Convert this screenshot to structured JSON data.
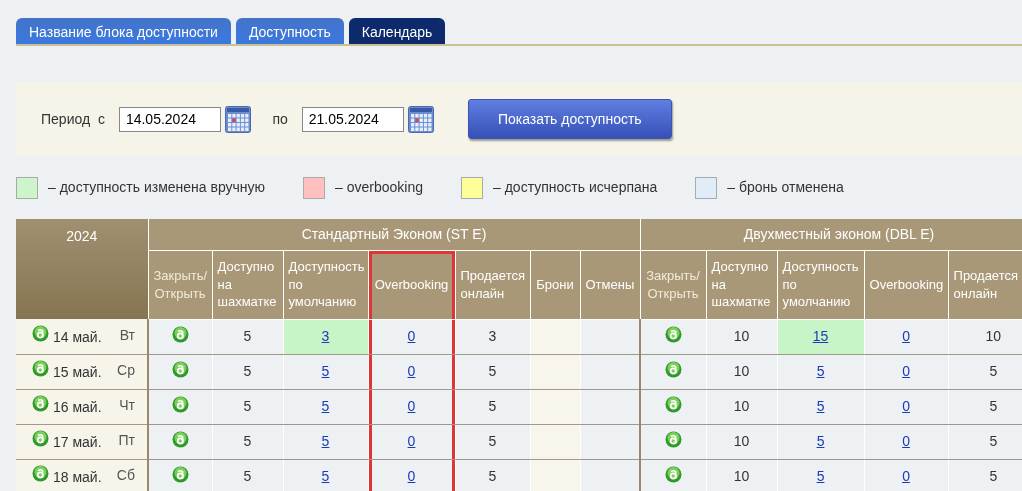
{
  "tabs": [
    {
      "label": "Название блока доступности",
      "selected": false
    },
    {
      "label": "Доступность",
      "selected": false
    },
    {
      "label": "Календарь",
      "selected": true
    }
  ],
  "filter": {
    "period_label": "Период  с",
    "date_from": "14.05.2024",
    "to_label": "по",
    "date_to": "21.05.2024",
    "button": "Показать доступность"
  },
  "legend": [
    {
      "color": "#ccf5cc",
      "label": "– доступность изменена вручную"
    },
    {
      "color": "#ffc0c0",
      "label": "– overbooking"
    },
    {
      "color": "#ffff99",
      "label": "– доступность исчерпана"
    },
    {
      "color": "#e0ecf8",
      "label": "– бронь отменена"
    }
  ],
  "table": {
    "year": "2024",
    "rooms": [
      {
        "name": "Стандартный Эконом (ST E)",
        "columns": [
          {
            "kind": "toggle",
            "label": "Закрыть/ Открыть",
            "highlighted": false
          },
          {
            "kind": "available",
            "label": "Доступно на шахматке",
            "highlighted": false
          },
          {
            "kind": "default",
            "label": "Доступность по умолчанию",
            "highlighted": false
          },
          {
            "kind": "overbooking",
            "label": "Overbooking",
            "highlighted": true
          },
          {
            "kind": "online",
            "label": "Продается онлайн",
            "highlighted": false
          },
          {
            "kind": "bookings",
            "label": "Брони",
            "highlighted": false
          },
          {
            "kind": "cancellations",
            "label": "Отмены",
            "highlighted": false
          }
        ]
      },
      {
        "name": "Двухместный эконом (DBL E)",
        "columns": [
          {
            "kind": "toggle",
            "label": "Закрыть/ Открыть",
            "highlighted": false
          },
          {
            "kind": "available",
            "label": "Доступно на шахматке",
            "highlighted": false
          },
          {
            "kind": "default",
            "label": "Доступность по умолчанию",
            "highlighted": false
          },
          {
            "kind": "overbooking",
            "label": "Overbooking",
            "highlighted": false
          },
          {
            "kind": "online",
            "label": "Продается онлайн",
            "highlighted": false
          }
        ]
      }
    ],
    "rows": [
      {
        "open": true,
        "date": "14 май.",
        "weekday": "Вт",
        "rooms": [
          {
            "open": true,
            "available": "5",
            "default": "3",
            "manual": true,
            "overbooking": "0",
            "online": "3"
          },
          {
            "open": true,
            "available": "10",
            "default": "15",
            "manual": true,
            "overbooking": "0",
            "online": "10"
          }
        ]
      },
      {
        "open": true,
        "date": "15 май.",
        "weekday": "Ср",
        "rooms": [
          {
            "open": true,
            "available": "5",
            "default": "5",
            "manual": false,
            "overbooking": "0",
            "online": "5"
          },
          {
            "open": true,
            "available": "10",
            "default": "5",
            "manual": false,
            "overbooking": "0",
            "online": "5"
          }
        ]
      },
      {
        "open": true,
        "date": "16 май.",
        "weekday": "Чт",
        "rooms": [
          {
            "open": true,
            "available": "5",
            "default": "5",
            "manual": false,
            "overbooking": "0",
            "online": "5"
          },
          {
            "open": true,
            "available": "10",
            "default": "5",
            "manual": false,
            "overbooking": "0",
            "online": "5"
          }
        ]
      },
      {
        "open": true,
        "date": "17 май.",
        "weekday": "Пт",
        "rooms": [
          {
            "open": true,
            "available": "5",
            "default": "5",
            "manual": false,
            "overbooking": "0",
            "online": "5"
          },
          {
            "open": true,
            "available": "10",
            "default": "5",
            "manual": false,
            "overbooking": "0",
            "online": "5"
          }
        ]
      },
      {
        "open": true,
        "date": "18 май.",
        "weekday": "Сб",
        "rooms": [
          {
            "open": true,
            "available": "5",
            "default": "5",
            "manual": false,
            "overbooking": "0",
            "online": "5"
          },
          {
            "open": true,
            "available": "10",
            "default": "5",
            "manual": false,
            "overbooking": "0",
            "online": "5"
          }
        ]
      }
    ]
  }
}
